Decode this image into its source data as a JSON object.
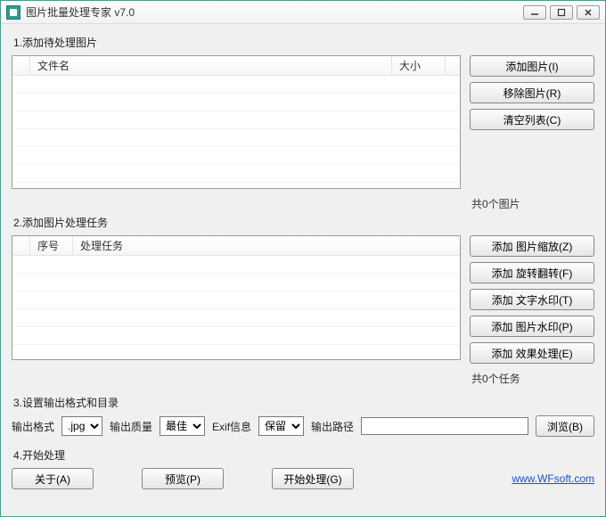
{
  "window": {
    "title": "图片批量处理专家 v7.0"
  },
  "section1": {
    "title": "1.添加待处理图片",
    "columns": {
      "filename": "文件名",
      "size": "大小"
    },
    "buttons": {
      "add": "添加图片(I)",
      "remove": "移除图片(R)",
      "clear": "清空列表(C)"
    },
    "count": "共0个图片"
  },
  "section2": {
    "title": "2.添加图片处理任务",
    "columns": {
      "index": "序号",
      "task": "处理任务"
    },
    "buttons": {
      "addResize": "添加 图片缩放(Z)",
      "addRotate": "添加 旋转翻转(F)",
      "addTextWM": "添加 文字水印(T)",
      "addImageWM": "添加 图片水印(P)",
      "addEffect": "添加 效果处理(E)"
    },
    "count": "共0个任务"
  },
  "section3": {
    "title": "3.设置输出格式和目录",
    "labels": {
      "format": "输出格式",
      "quality": "输出质量",
      "exif": "Exif信息",
      "path": "输出路径"
    },
    "options": {
      "format": [
        ".jpg"
      ],
      "quality": [
        "最佳"
      ],
      "exif": [
        "保留"
      ]
    },
    "selected": {
      "format": ".jpg",
      "quality": "最佳",
      "exif": "保留"
    },
    "browseBtn": "浏览(B)",
    "pathValue": ""
  },
  "section4": {
    "title": "4.开始处理",
    "buttons": {
      "about": "关于(A)",
      "preview": "预览(P)",
      "start": "开始处理(G)"
    },
    "link": "www.WFsoft.com"
  }
}
